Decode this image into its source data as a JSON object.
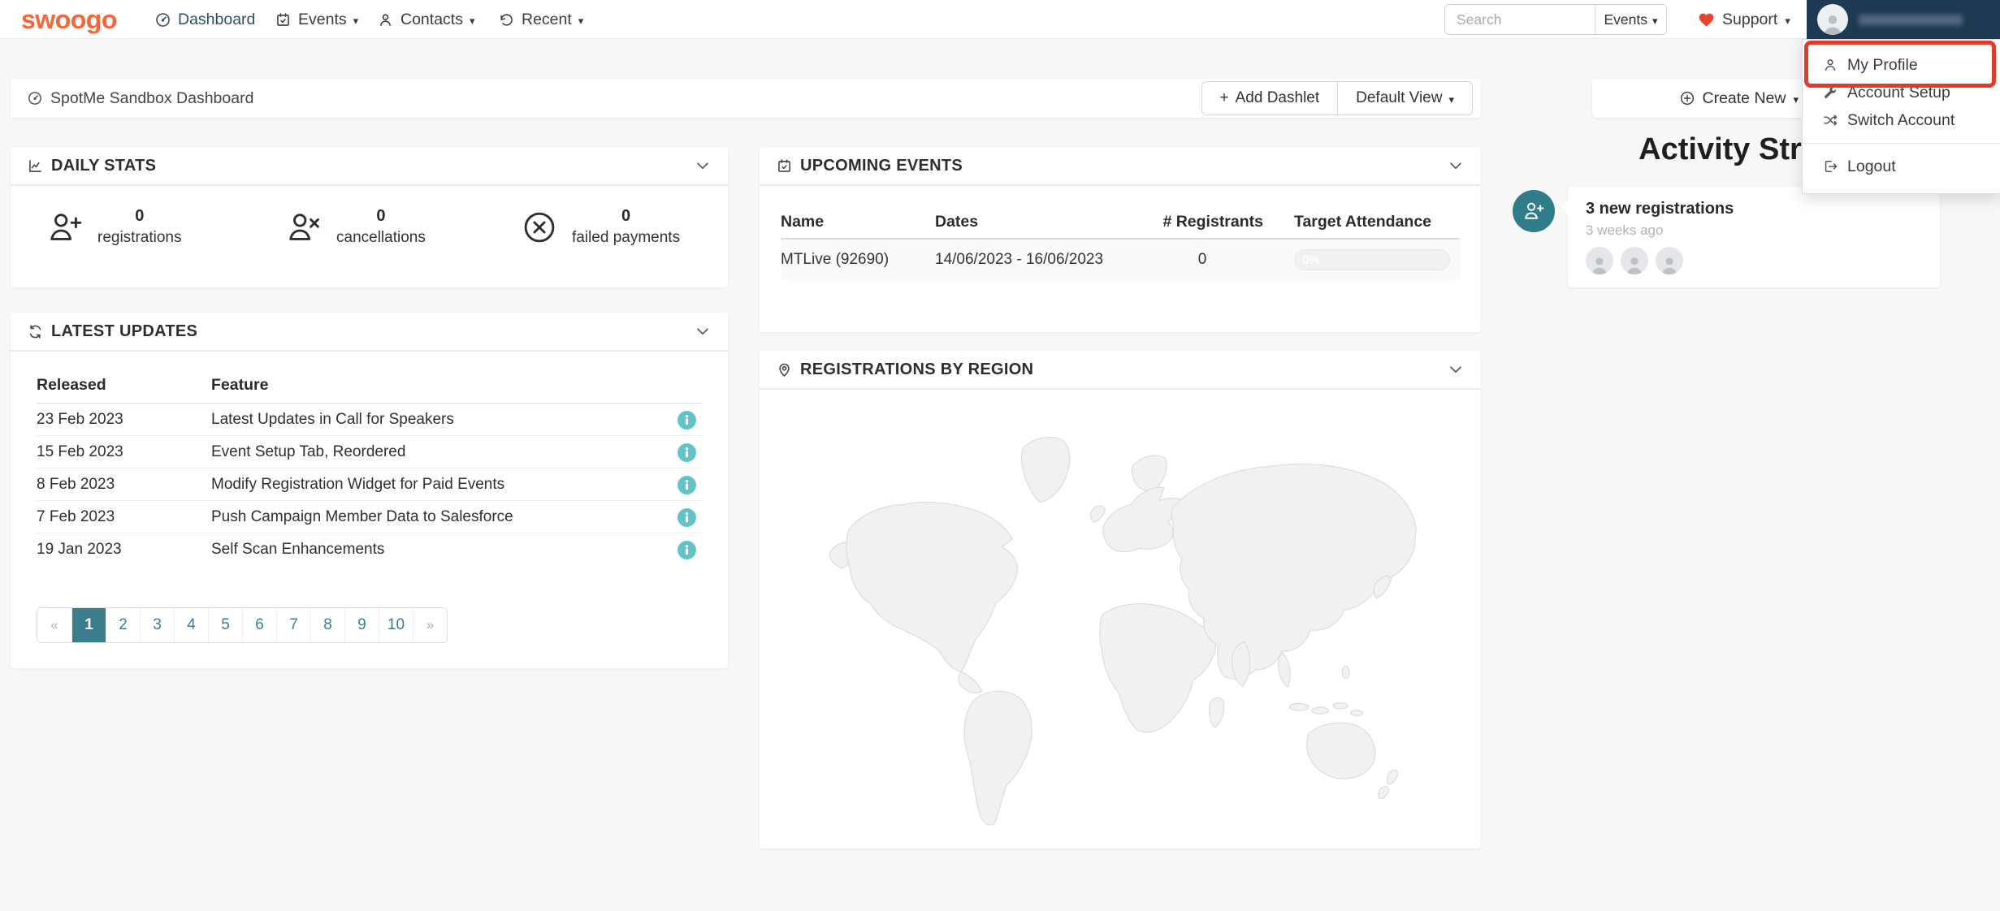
{
  "icons": {
    "caret_down": "▾",
    "plus": "+"
  },
  "colors": {
    "accent_orange": "#F2683C",
    "teal_info": "#5FC3C7",
    "teal_dark": "#3C7D8D",
    "navy": "#1E3A52",
    "highlight_red": "#E23A2C"
  },
  "navbar": {
    "logo": "swoogo",
    "items": [
      {
        "label": "Dashboard"
      },
      {
        "label": "Events"
      },
      {
        "label": "Contacts"
      },
      {
        "label": "Recent"
      }
    ],
    "search": {
      "placeholder": "Search",
      "scope": "Events"
    },
    "support": "Support"
  },
  "user_menu": {
    "my_profile": "My Profile",
    "account_setup": "Account Setup",
    "switch_account": "Switch Account",
    "logout": "Logout"
  },
  "toolbar": {
    "title": "SpotMe Sandbox Dashboard",
    "add_dashlet": "Add Dashlet",
    "default_view": "Default View"
  },
  "create_new": {
    "label": "Create New"
  },
  "activity_stream": {
    "title": "Activity Stream",
    "items": [
      {
        "title": "3 new registrations",
        "time": "3 weeks ago",
        "avatar_count": 3
      }
    ]
  },
  "daily_stats": {
    "title": "DAILY STATS",
    "stats": [
      {
        "value": "0",
        "label": "registrations"
      },
      {
        "value": "0",
        "label": "cancellations"
      },
      {
        "value": "0",
        "label": "failed payments"
      }
    ]
  },
  "upcoming_events": {
    "title": "UPCOMING EVENTS",
    "columns": [
      "Name",
      "Dates",
      "# Registrants",
      "Target Attendance"
    ],
    "rows": [
      {
        "name": "MTLive (92690)",
        "dates": "14/06/2023 - 16/06/2023",
        "registrants": "0",
        "target_attendance": "0%"
      }
    ]
  },
  "latest_updates": {
    "title": "LATEST UPDATES",
    "columns": [
      "Released",
      "Feature"
    ],
    "rows": [
      {
        "released": "23 Feb 2023",
        "feature": "Latest Updates in Call for Speakers"
      },
      {
        "released": "15 Feb 2023",
        "feature": "Event Setup Tab, Reordered"
      },
      {
        "released": "8 Feb 2023",
        "feature": "Modify Registration Widget for Paid Events"
      },
      {
        "released": "7 Feb 2023",
        "feature": "Push Campaign Member Data to Salesforce"
      },
      {
        "released": "19 Jan 2023",
        "feature": "Self Scan Enhancements"
      }
    ],
    "pagination": {
      "prev": "«",
      "pages": [
        "1",
        "2",
        "3",
        "4",
        "5",
        "6",
        "7",
        "8",
        "9",
        "10"
      ],
      "next": "»",
      "active": "1"
    }
  },
  "registrations_by_region": {
    "title": "REGISTRATIONS BY REGION"
  }
}
